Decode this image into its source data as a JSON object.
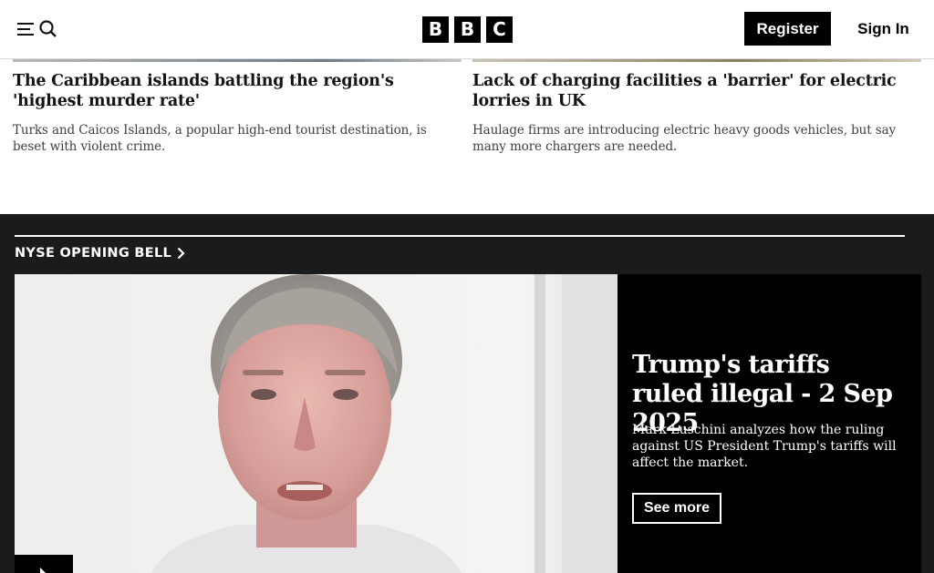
{
  "header": {
    "menu_icon": "menu-search-icon",
    "logo_letters": [
      "B",
      "B",
      "C"
    ],
    "register_label": "Register",
    "signin_label": "Sign In"
  },
  "stories": [
    {
      "title": "The Caribbean islands battling the region's 'highest murder rate'",
      "description": "Turks and Caicos Islands, a popular high-end tourist destination, is beset with violent crime."
    },
    {
      "title": "Lack of charging facilities a 'barrier' for electric lorries in UK",
      "description": "Haulage firms are introducing electric heavy goods vehicles, but say many more chargers are needed."
    }
  ],
  "section": {
    "title": "NYSE OPENING BELL",
    "chevron_icon": "chevron-right-icon"
  },
  "feature": {
    "headline": "Trump's tariffs ruled illegal - 2 Sep 2025",
    "description": "Mark Luschini analyzes how the ruling against US President Trump's tariffs will affect the market.",
    "see_more_label": "See more",
    "play_icon": "play-icon"
  },
  "colors": {
    "dark_background": "#1a1b1d",
    "panel_background": "#000000",
    "brand_black": "#000000"
  }
}
